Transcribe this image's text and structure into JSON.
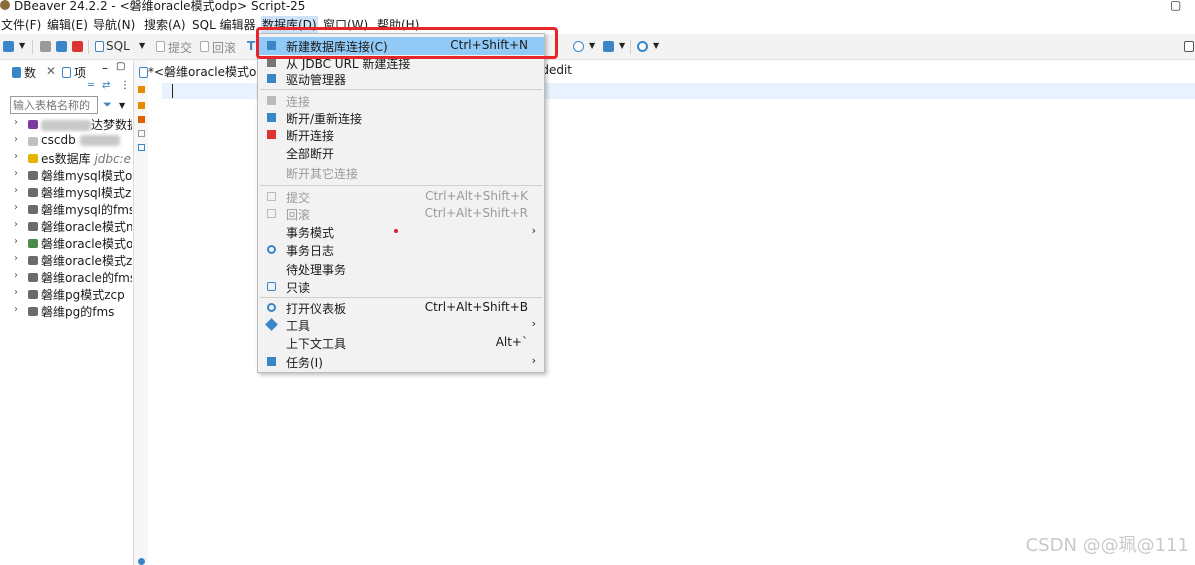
{
  "window": {
    "title": "DBeaver 24.2.2 - <磐维oracle模式odp> Script-25",
    "maximize_icon": "maximize-icon"
  },
  "menubar": [
    "文件(F)",
    "编辑(E)",
    "导航(N)",
    "搜索(A)",
    "SQL 编辑器",
    "数据库(D)",
    "窗口(W)",
    "帮助(H)"
  ],
  "toolbar": {
    "sql": "SQL",
    "commit": "提交",
    "rollback": "回滚"
  },
  "left_panel": {
    "tab_db": "数",
    "tab_project": "项",
    "filter_placeholder": "输入表格名称的",
    "tree": [
      {
        "label": "达梦数据"
      },
      {
        "label": "cscdb"
      },
      {
        "label": "es数据库",
        "extra": "jdbc:e..."
      },
      {
        "label": "磐维mysql模式od"
      },
      {
        "label": "磐维mysql模式zc"
      },
      {
        "label": "磐维mysql的fms"
      },
      {
        "label": "磐维oracle模式n"
      },
      {
        "label": "磐维oracle模式od"
      },
      {
        "label": "磐维oracle模式zc"
      },
      {
        "label": "磐维oracle的fms"
      },
      {
        "label": "磐维pg模式zcp"
      },
      {
        "label": "磐维pg的fms"
      }
    ]
  },
  "editor": {
    "tab_label": "*<磐维oracle模式od",
    "tab2_label": "ldedit"
  },
  "dropdown": {
    "items": [
      {
        "label": "新建数据库连接(C)",
        "shortcut": "Ctrl+Shift+N",
        "state": "highlighted"
      },
      {
        "label": "从 JDBC URL 新建连接",
        "state": "normal"
      },
      {
        "label": "驱动管理器",
        "state": "normal"
      },
      {
        "label": "连接",
        "state": "disabled"
      },
      {
        "label": "断开/重新连接",
        "state": "normal"
      },
      {
        "label": "断开连接",
        "state": "normal"
      },
      {
        "label": "全部断开",
        "state": "normal"
      },
      {
        "label": "断开其它连接",
        "state": "disabled"
      },
      {
        "label": "提交",
        "shortcut": "Ctrl+Alt+Shift+K",
        "state": "disabled"
      },
      {
        "label": "回滚",
        "shortcut": "Ctrl+Alt+Shift+R",
        "state": "disabled"
      },
      {
        "label": "事务模式",
        "submenu": "›",
        "state": "normal"
      },
      {
        "label": "事务日志",
        "state": "normal"
      },
      {
        "label": "待处理事务",
        "state": "normal"
      },
      {
        "label": "只读",
        "state": "normal"
      },
      {
        "label": "打开仪表板",
        "shortcut": "Ctrl+Alt+Shift+B",
        "state": "normal"
      },
      {
        "label": "工具",
        "submenu": "›",
        "state": "normal"
      },
      {
        "label": "上下文工具",
        "shortcut": "Alt+`",
        "state": "normal"
      },
      {
        "label": "任务(I)",
        "submenu": "›",
        "state": "normal"
      }
    ]
  },
  "colors": {
    "highlight": "#91c9f7",
    "annotation_box": "#e8262a",
    "menu_active": "#cfe3f8"
  },
  "watermark": "CSDN @@珮@111"
}
